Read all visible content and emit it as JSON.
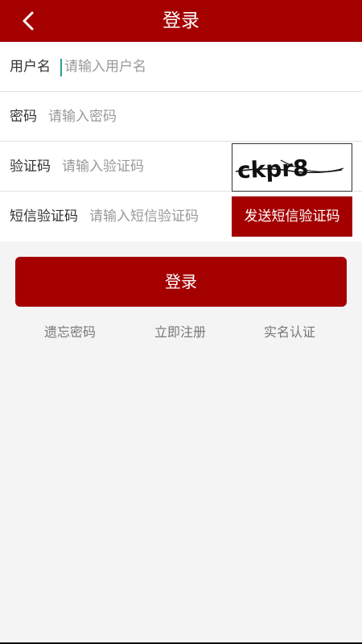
{
  "header": {
    "title": "登录",
    "back_icon": "chevron-left-icon",
    "background_color": "#a40000"
  },
  "form": {
    "username": {
      "label": "用户名",
      "placeholder": "请输入用户名",
      "value": ""
    },
    "password": {
      "label": "密码",
      "placeholder": "请输入密码",
      "value": ""
    },
    "captcha": {
      "label": "验证码",
      "placeholder": "请输入验证码",
      "value": "",
      "image_text": "ckpr8"
    },
    "sms": {
      "label": "短信验证码",
      "placeholder": "请输入短信验证码",
      "value": "",
      "button_label": "发送短信验证码"
    }
  },
  "login_button": {
    "label": "登录"
  },
  "links": {
    "forgot_password": "遗忘密码",
    "register": "立即注册",
    "real_name_auth": "实名认证"
  },
  "colors": {
    "accent": "#a40000",
    "page_background": "#f4f4f4",
    "caret": "#2a9d8f"
  }
}
